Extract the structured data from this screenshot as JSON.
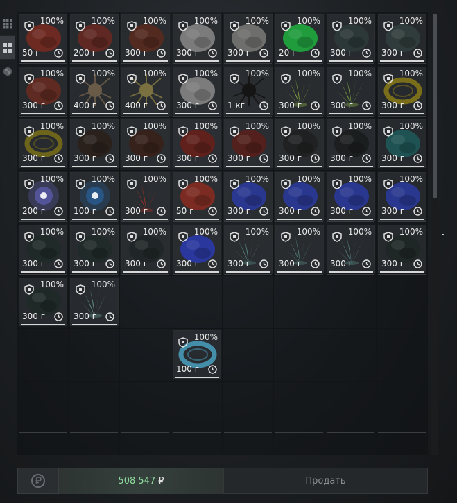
{
  "sidebar": {
    "tabs": [
      {
        "name": "grid-small-icon",
        "active": false
      },
      {
        "name": "grid-large-icon",
        "active": true
      },
      {
        "name": "artifact-icon",
        "active": false
      }
    ]
  },
  "items": [
    {
      "condition": "100%",
      "weight": "50 г",
      "color": "#7a2a20",
      "art": "blob"
    },
    {
      "condition": "100%",
      "weight": "200 г",
      "color": "#6a2820",
      "art": "blob"
    },
    {
      "condition": "100%",
      "weight": "300 г",
      "color": "#5a2a1c",
      "art": "blob"
    },
    {
      "condition": "100%",
      "weight": "300 г",
      "color": "#8a8a88",
      "art": "blob"
    },
    {
      "condition": "100%",
      "weight": "300 г",
      "color": "#7a7a78",
      "art": "blob"
    },
    {
      "condition": "100%",
      "weight": "20 г",
      "color": "#1fb040",
      "art": "blob"
    },
    {
      "condition": "100%",
      "weight": "300 г",
      "color": "#2e3a38",
      "art": "blob"
    },
    {
      "condition": "100%",
      "weight": "300 г",
      "color": "#33403e",
      "art": "blob"
    },
    {
      "condition": "100%",
      "weight": "300 г",
      "color": "#6a2a1e",
      "art": "blob"
    },
    {
      "condition": "100%",
      "weight": "400 г",
      "color": "#6a5a48",
      "art": "spiky"
    },
    {
      "condition": "100%",
      "weight": "400 г",
      "color": "#7a7040",
      "art": "spiky"
    },
    {
      "condition": "100%",
      "weight": "300 г",
      "color": "#8a8a88",
      "art": "blob"
    },
    {
      "condition": "100%",
      "weight": "1 кг",
      "color": "#151515",
      "art": "spiky"
    },
    {
      "condition": "100%",
      "weight": "300 г",
      "color": "#8ab048",
      "art": "crystal"
    },
    {
      "condition": "100%",
      "weight": "300 г",
      "color": "#8ab048",
      "art": "crystal"
    },
    {
      "condition": "100%",
      "weight": "300 г",
      "color": "#8a7a18",
      "art": "ring"
    },
    {
      "condition": "100%",
      "weight": "300 г",
      "color": "#7a7018",
      "art": "ring"
    },
    {
      "condition": "100%",
      "weight": "300 г",
      "color": "#2a201a",
      "art": "blob"
    },
    {
      "condition": "100%",
      "weight": "300 г",
      "color": "#3a2018",
      "art": "blob"
    },
    {
      "condition": "100%",
      "weight": "300 г",
      "color": "#6a1e1a",
      "art": "blob"
    },
    {
      "condition": "100%",
      "weight": "300 г",
      "color": "#5a1e1a",
      "art": "blob"
    },
    {
      "condition": "100%",
      "weight": "300 г",
      "color": "#1e2020",
      "art": "blob"
    },
    {
      "condition": "100%",
      "weight": "300 г",
      "color": "#1a1c1c",
      "art": "blob"
    },
    {
      "condition": "100%",
      "weight": "300 г",
      "color": "#1e5a5a",
      "art": "blob"
    },
    {
      "condition": "100%",
      "weight": "200 г",
      "color": "#6a6ad0",
      "art": "glow"
    },
    {
      "condition": "100%",
      "weight": "100 г",
      "color": "#2a6ab0",
      "art": "glow"
    },
    {
      "condition": "100%",
      "weight": "300 г",
      "color": "#a03028",
      "art": "crystal"
    },
    {
      "condition": "100%",
      "weight": "50 г",
      "color": "#8a2a1e",
      "art": "blob"
    },
    {
      "condition": "100%",
      "weight": "300 г",
      "color": "#2a3aa0",
      "art": "blob"
    },
    {
      "condition": "100%",
      "weight": "300 г",
      "color": "#2a3aa0",
      "art": "blob"
    },
    {
      "condition": "100%",
      "weight": "300 г",
      "color": "#2a3aa0",
      "art": "blob"
    },
    {
      "condition": "100%",
      "weight": "300 г",
      "color": "#2a3aa0",
      "art": "blob"
    },
    {
      "condition": "100%",
      "weight": "300 г",
      "color": "#1e2a28",
      "art": "blob"
    },
    {
      "condition": "100%",
      "weight": "300 г",
      "color": "#1e2a28",
      "art": "blob"
    },
    {
      "condition": "100%",
      "weight": "300 г",
      "color": "#1e2626",
      "art": "blob"
    },
    {
      "condition": "100%",
      "weight": "300 г",
      "color": "#2a3ab0",
      "art": "blob"
    },
    {
      "condition": "100%",
      "weight": "300 г",
      "color": "#5a8a88",
      "art": "crystal"
    },
    {
      "condition": "100%",
      "weight": "300 г",
      "color": "#5a8a88",
      "art": "crystal"
    },
    {
      "condition": "100%",
      "weight": "300 г",
      "color": "#5a8a88",
      "art": "crystal"
    },
    {
      "condition": "100%",
      "weight": "300 г",
      "color": "#1e2626",
      "art": "blob"
    },
    {
      "condition": "100%",
      "weight": "300 г",
      "color": "#1e2a28",
      "art": "blob"
    },
    {
      "condition": "100%",
      "weight": "300 г",
      "color": "#6a9a98",
      "art": "crystal"
    }
  ],
  "extra_item": {
    "condition": "100%",
    "weight": "100 г",
    "color": "#4aa0c0",
    "art": "ring"
  },
  "footer": {
    "balance_value": "508 547",
    "currency_symbol": "₽",
    "sell_label": "Продать"
  },
  "colors": {
    "balance": "#8fdc9e",
    "underline": "#d9d9d9"
  }
}
